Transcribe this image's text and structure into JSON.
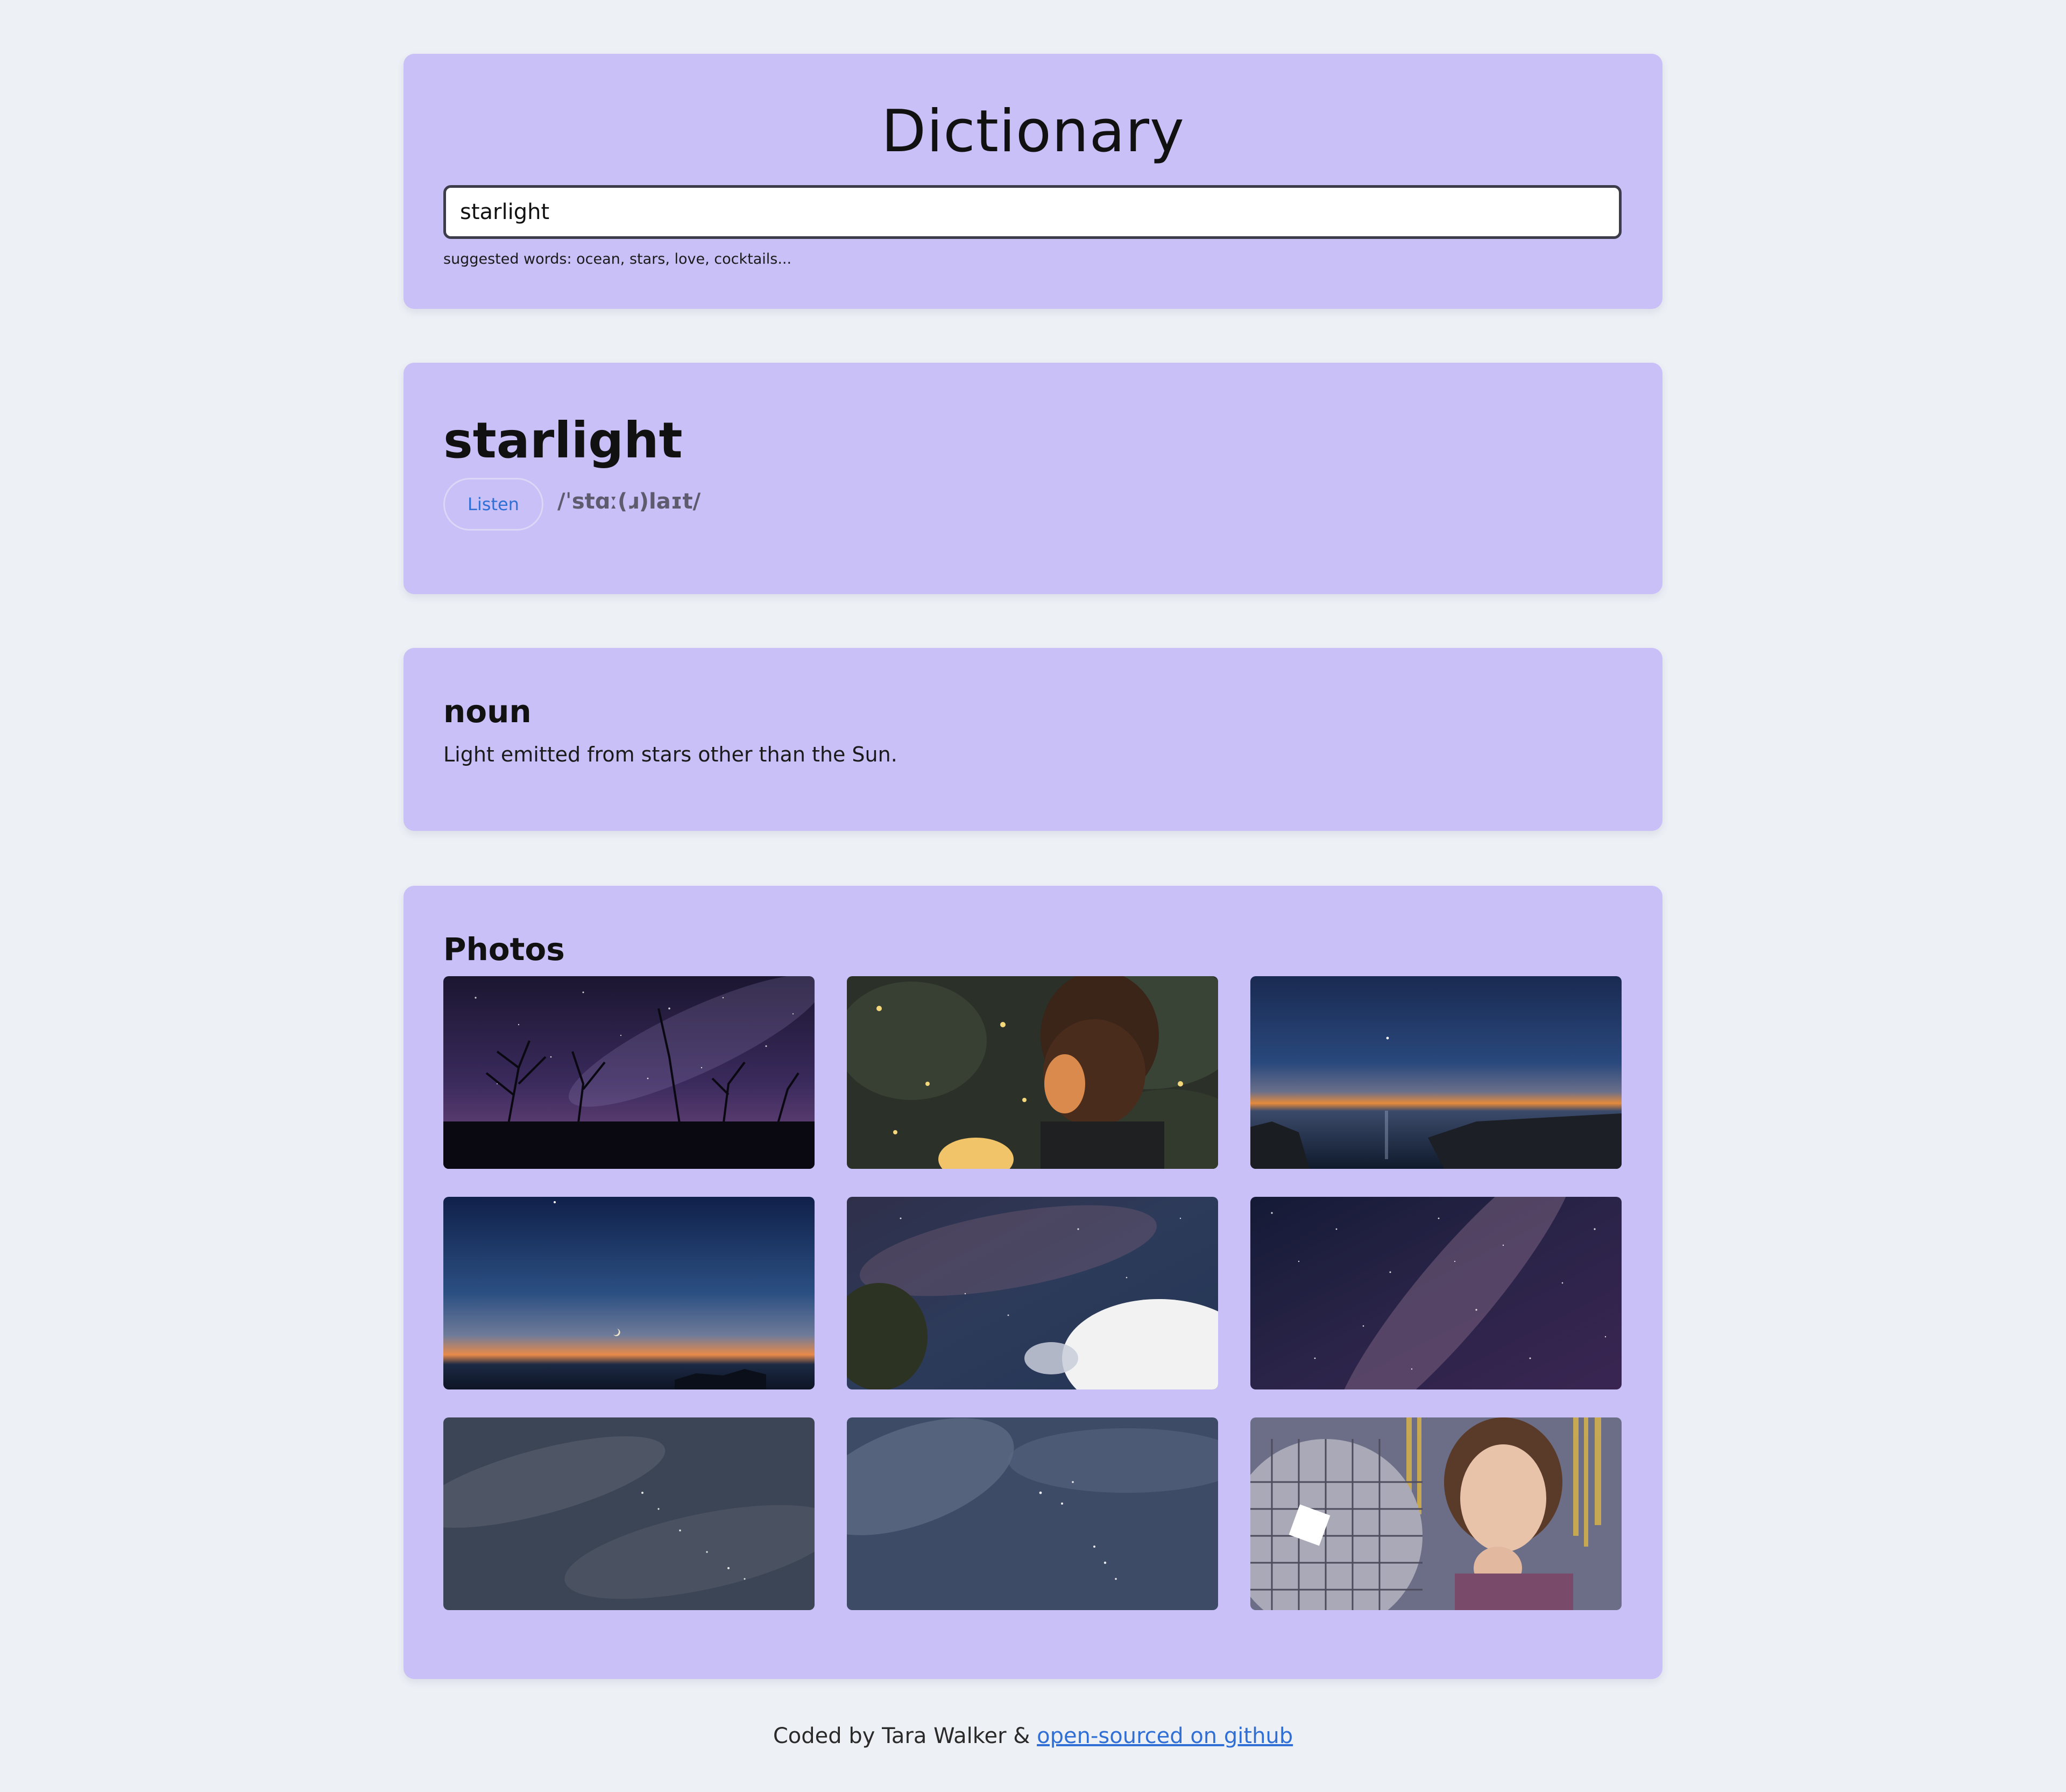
{
  "header": {
    "title": "Dictionary"
  },
  "search": {
    "value": "starlight",
    "hint": "suggested words: ocean, stars, love, cocktails..."
  },
  "word": {
    "text": "starlight",
    "listen_label": "Listen",
    "phonetic": "/ˈstɑː(ɹ)laɪt/"
  },
  "meaning": {
    "part_of_speech": "noun",
    "definition": "Light emitted from stars other than the Sun."
  },
  "photos": {
    "heading": "Photos",
    "items": [
      {
        "subject": "milky-way-over-trees"
      },
      {
        "subject": "child-looking-at-fireflies"
      },
      {
        "subject": "twilight-over-sea"
      },
      {
        "subject": "crescent-moon-sunset"
      },
      {
        "subject": "milky-way-with-clouds"
      },
      {
        "subject": "dense-starfield"
      },
      {
        "subject": "cloudy-night-sky-1"
      },
      {
        "subject": "cloudy-night-sky-2"
      },
      {
        "subject": "woman-with-disco-ball"
      }
    ]
  },
  "footer": {
    "credit": "Coded by Tara Walker & ",
    "link_label": "open-sourced on github"
  },
  "colors": {
    "background": "#edf0f5",
    "card": "#c8c0f6",
    "link": "#2f6fd6",
    "phonetic": "#5f5b6e"
  }
}
